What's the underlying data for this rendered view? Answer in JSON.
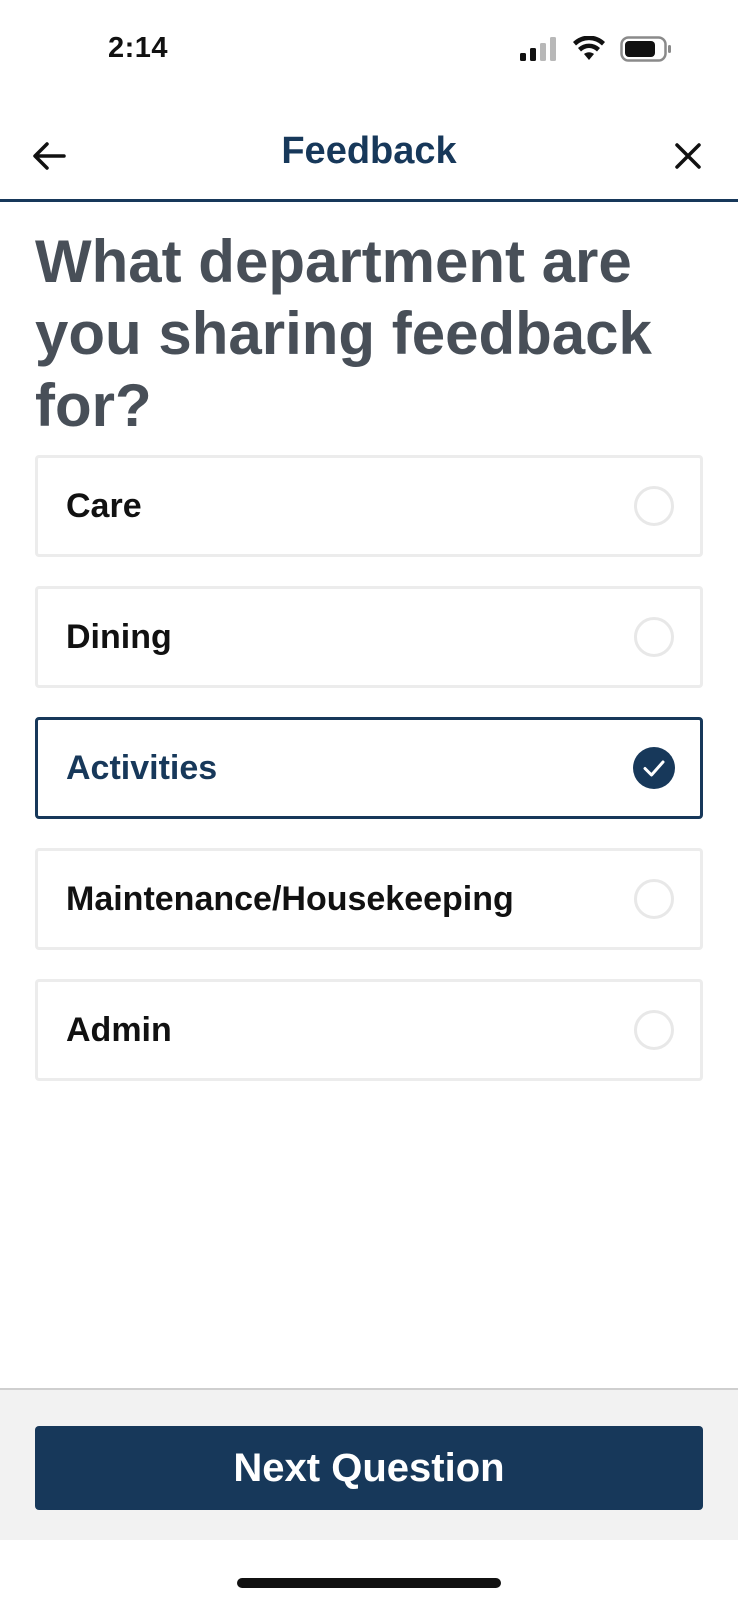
{
  "status_bar": {
    "time": "2:14",
    "icons": [
      "cellular-signal-icon",
      "wifi-icon",
      "battery-icon"
    ]
  },
  "nav": {
    "title": "Feedback",
    "back_icon": "arrow-left-icon",
    "close_icon": "close-icon"
  },
  "question": "What department are you sharing feedback for?",
  "options": [
    {
      "label": "Care",
      "selected": false
    },
    {
      "label": "Dining",
      "selected": false
    },
    {
      "label": "Activities",
      "selected": true
    },
    {
      "label": "Maintenance/Housekeeping",
      "selected": false
    },
    {
      "label": "Admin",
      "selected": false
    }
  ],
  "footer": {
    "next_label": "Next Question"
  },
  "colors": {
    "primary": "#17385a",
    "question_text": "#484f58",
    "option_border": "#ececec",
    "footer_bg": "#f2f2f2"
  }
}
